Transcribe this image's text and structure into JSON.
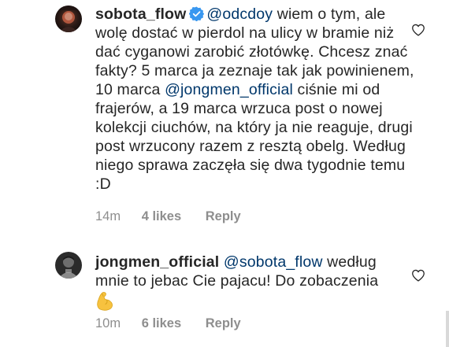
{
  "comments": [
    {
      "username": "sobota_flow",
      "verified": true,
      "verified_icon": "verified-badge-icon",
      "mention": "@odcdoy",
      "text_1": " wiem o tym, ale wolę dostać w pierdol na ulicy w bramie niż dać cyganowi zarobić złotówkę. Chcesz znać fakty? 5 marca ja zeznaje tak jak powinienem, 10 marca ",
      "mention_2": "@jongmen_official",
      "text_2": " ciśnie mi od frajerów, a 19 marca wrzuca post o nowej kolekcji ciuchów, na który ja nie reaguje, drugi post wrzucony razem z resztą obelg. Według niego sprawa zaczęła się dwa tygodnie temu :D",
      "time": "14m",
      "likes": "4 likes",
      "reply": "Reply",
      "like_icon": "heart-outline-icon"
    },
    {
      "username": "jongmen_official",
      "verified": false,
      "mention": "@sobota_flow",
      "text_1": " według mnie to jebac Cie pajacu! Do zobaczenia",
      "emoji_icon": "flexed-biceps-icon",
      "time": "10m",
      "likes": "6 likes",
      "reply": "Reply",
      "like_icon": "heart-outline-icon"
    }
  ],
  "colors": {
    "text": "#262626",
    "mention": "#00376b",
    "meta": "#8e8e8e",
    "verified": "#3897f0",
    "background": "#ffffff"
  }
}
